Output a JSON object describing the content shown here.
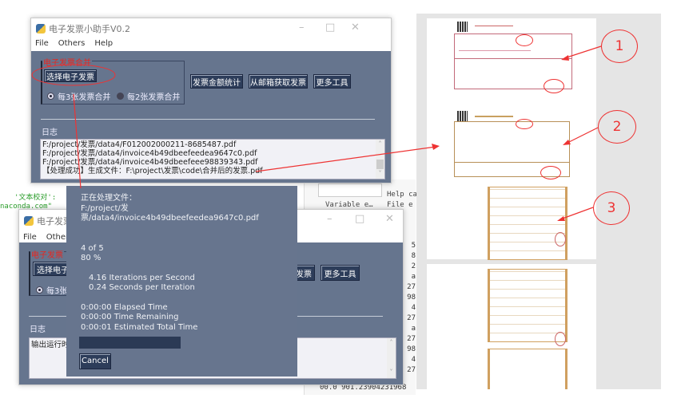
{
  "main_window": {
    "title": "电子发票小助手V0.2",
    "menu": [
      "File",
      "Others",
      "Help"
    ],
    "group_label": "电子发票合并",
    "select_button": "选择电子发票",
    "radio_options": [
      {
        "label": "每3张发票合并",
        "selected": true
      },
      {
        "label": "每2张发票合并",
        "selected": false
      }
    ],
    "buttons": [
      "发票金额统计",
      "从邮箱获取发票",
      "更多工具"
    ],
    "log_label": "日志",
    "log_lines": [
      "F:/project/发票/data4/F012002000211-8685487.pdf",
      "F:/project/发票/data4/invoice4b49dbeefeedea9647c0.pdf",
      "F:/project/发票/data4/invoice4b49dbeefeee98839343.pdf",
      "【处理成功】生成文件：F:\\project\\发票\\code\\合并后的发票.pdf"
    ]
  },
  "second_window": {
    "title": "电子发票",
    "menu": [
      "File",
      "Others"
    ],
    "group_label": "电子发票",
    "select_button": "选择电子",
    "radio_label": "每3张",
    "partial_button": "发票",
    "more_button": "更多工具",
    "log_label": "日志",
    "log_text": "输出运行时"
  },
  "progress_dialog": {
    "heading": "正在处理文件：",
    "file": "F:/project/发票/data4/invoice4b49dbeefeedea9647c0.pdf",
    "count": "4 of 5",
    "percent_text": "80 %",
    "progress": 0.8,
    "rate": "4.16 Iterations per Second",
    "spi": "0.24 Seconds per Iteration",
    "elapsed": "0:00:00 Elapsed Time",
    "remaining": "0:00:00 Time Remaining",
    "total": "0:00:01 Estimated Total Time",
    "cancel": "Cancel"
  },
  "background": {
    "code_lines": [
      "'文本校对':",
      "naconda.com\""
    ],
    "help_tab": "Help ca",
    "variable_tab": "Variable e…",
    "file_tab": "File e",
    "numbers": [
      "5",
      "8",
      "2",
      "a",
      "27",
      "98",
      "4",
      "27",
      "a",
      "27",
      "98",
      "4",
      "27"
    ],
    "bottom_line": "00.0 901.23904231968"
  },
  "annotations": {
    "labels": [
      "1",
      "2",
      "3"
    ],
    "color": "#e33333"
  },
  "colors": {
    "window_body": "#66758e",
    "button": "#2d3d5a",
    "group_label": "#e8261f"
  }
}
